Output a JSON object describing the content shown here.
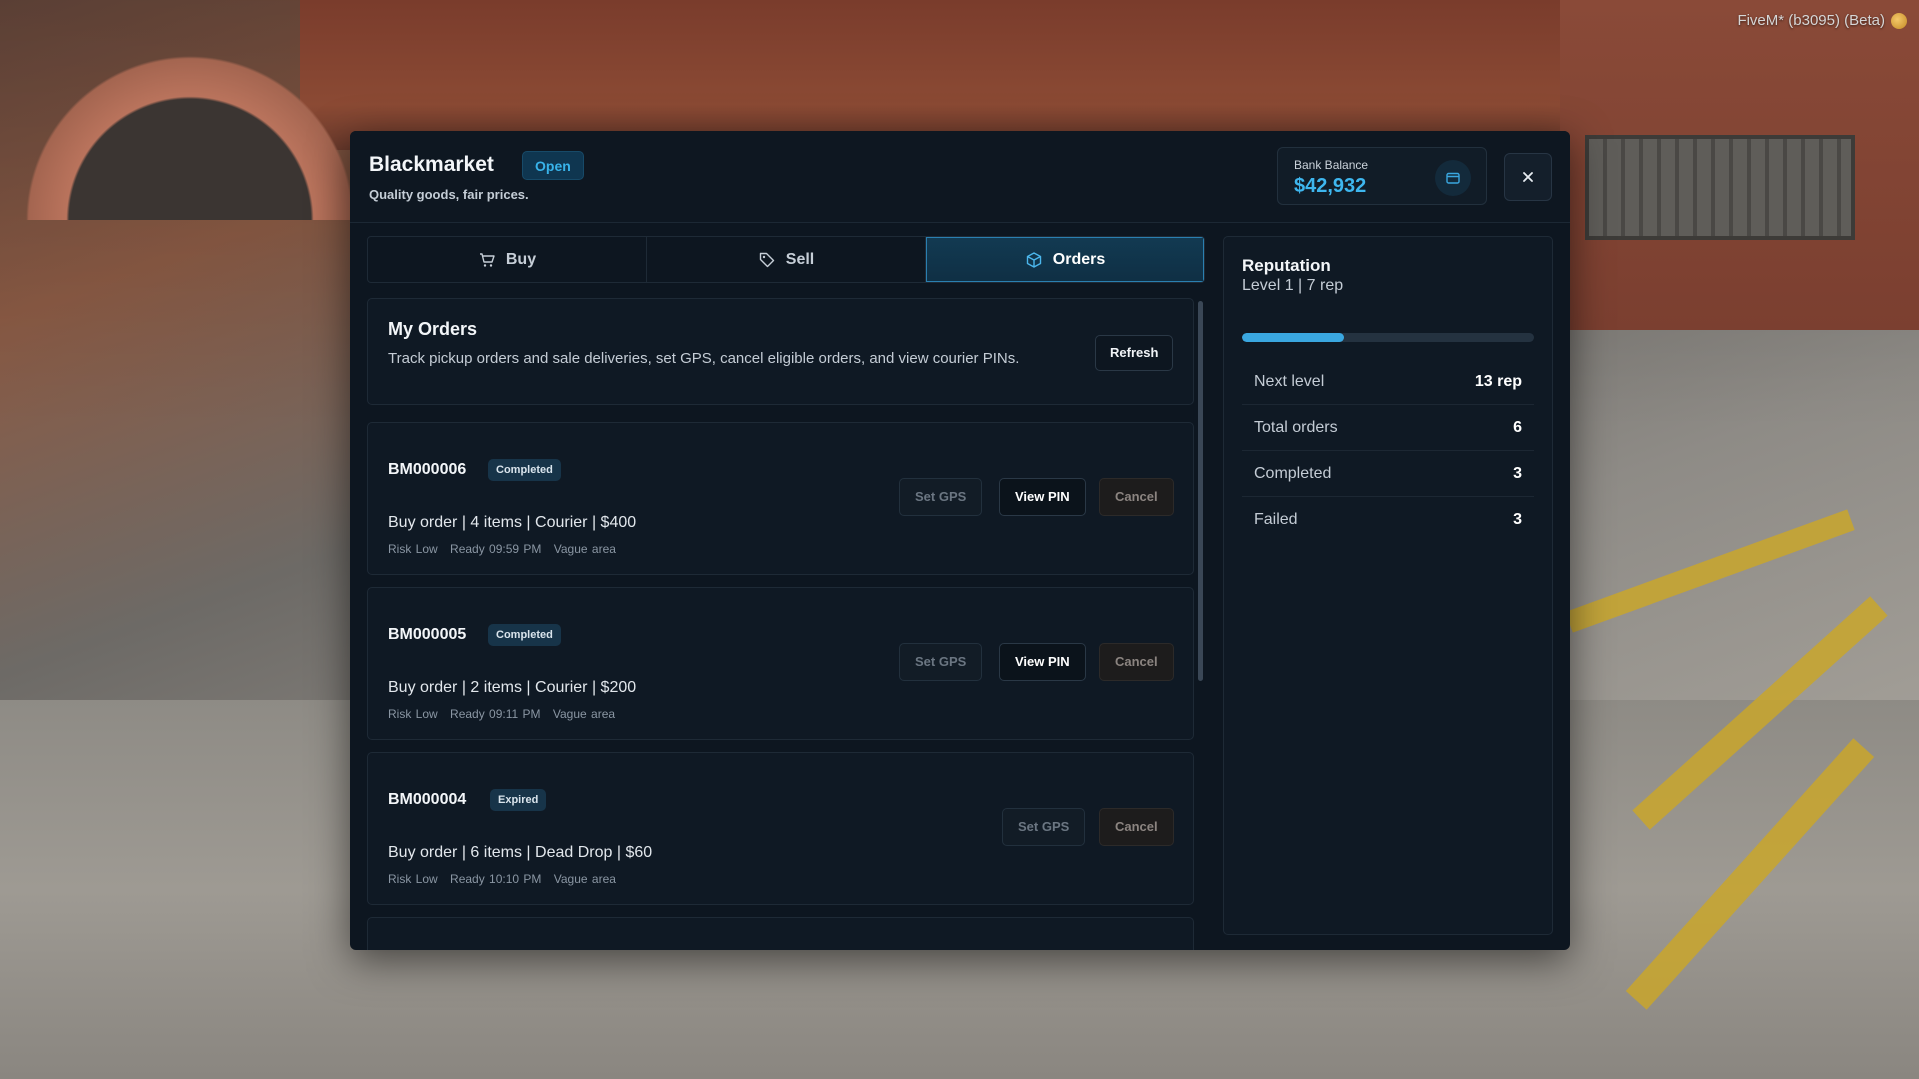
{
  "hud": {
    "client": "FiveM* (b3095) (Beta)"
  },
  "header": {
    "title": "Blackmarket",
    "status": "Open",
    "subtitle": "Quality goods, fair prices.",
    "bank_label": "Bank Balance",
    "bank_value": "$42,932"
  },
  "tabs": [
    {
      "label": "Buy",
      "icon": "cart-icon"
    },
    {
      "label": "Sell",
      "icon": "tag-icon"
    },
    {
      "label": "Orders",
      "icon": "box-icon",
      "active": true
    }
  ],
  "my_orders": {
    "title": "My Orders",
    "description": "Track pickup orders and sale deliveries, set GPS, cancel eligible orders, and view courier PINs.",
    "refresh_label": "Refresh"
  },
  "orders": [
    {
      "id": "BM000006",
      "status": "Completed",
      "summary": "Buy order | 4 items | Courier | $400",
      "risk": "Risk Low",
      "ready": "Ready 09:59 PM",
      "area": "Vague area",
      "gps": "Set GPS",
      "pin": "View PIN",
      "cancel": "Cancel"
    },
    {
      "id": "BM000005",
      "status": "Completed",
      "summary": "Buy order | 2 items | Courier | $200",
      "risk": "Risk Low",
      "ready": "Ready 09:11 PM",
      "area": "Vague area",
      "gps": "Set GPS",
      "pin": "View PIN",
      "cancel": "Cancel"
    },
    {
      "id": "BM000004",
      "status": "Expired",
      "summary": "Buy order | 6 items | Dead Drop | $60",
      "risk": "Risk Low",
      "ready": "Ready 10:10 PM",
      "area": "Vague area",
      "gps": "Set GPS",
      "cancel": "Cancel"
    }
  ],
  "reputation": {
    "title": "Reputation",
    "level": "Level 1 | 7 rep",
    "progress": 0.35,
    "rows": [
      {
        "label": "Next level",
        "value": "13 rep"
      },
      {
        "label": "Total orders",
        "value": "6"
      },
      {
        "label": "Completed",
        "value": "3"
      },
      {
        "label": "Failed",
        "value": "3"
      }
    ]
  },
  "colors": {
    "accent": "#3aa7e0",
    "panel": "#0d1620"
  }
}
